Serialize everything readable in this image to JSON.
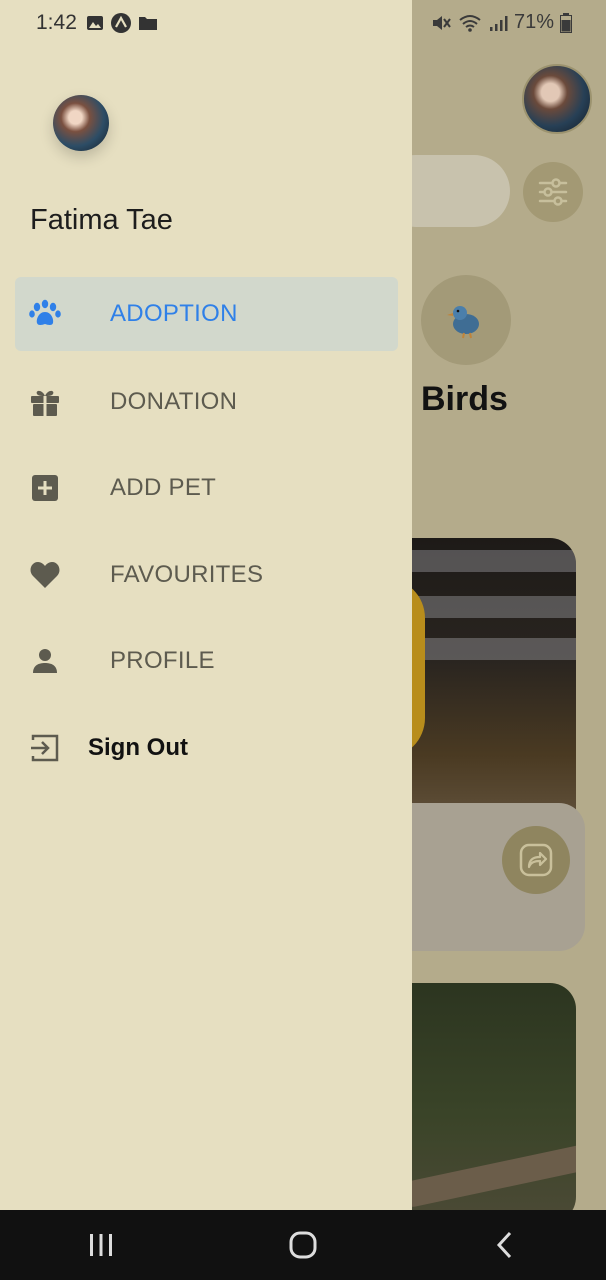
{
  "status_bar": {
    "time": "1:42",
    "battery": "71%",
    "left_icons": [
      "image-icon",
      "app-icon",
      "folder-icon"
    ],
    "right_icons": [
      "mute-icon",
      "wifi-icon",
      "signal-icon",
      "battery-icon"
    ]
  },
  "drawer": {
    "user_name": "Fatima Tae",
    "menu": [
      {
        "label": "ADOPTION",
        "icon": "paw-icon",
        "active": true
      },
      {
        "label": "DONATION",
        "icon": "gift-icon",
        "active": false
      },
      {
        "label": "ADD PET",
        "icon": "add-box-icon",
        "active": false
      },
      {
        "label": "FAVOURITES",
        "icon": "heart-icon",
        "active": false
      },
      {
        "label": "PROFILE",
        "icon": "person-icon",
        "active": false
      }
    ],
    "sign_out_label": "Sign Out"
  },
  "background": {
    "category_label": "Birds"
  },
  "colors": {
    "drawer_bg": "#e6dfc1",
    "active_item_bg": "#d2d8cc",
    "accent": "#2f80e8",
    "menu_text": "#5d5b4f"
  }
}
